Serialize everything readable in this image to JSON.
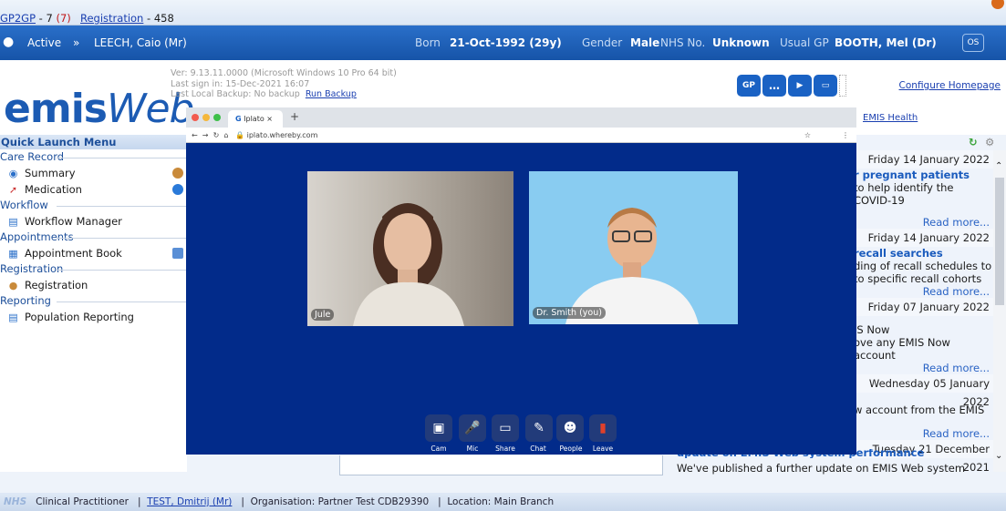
{
  "topbar": {
    "gp2gp_link": "GP2GP",
    "gp2gp_count": " - 7 ",
    "gp2gp_alert": "(7)",
    "registration_link": "Registration",
    "registration_count": " - 458"
  },
  "patient": {
    "status": "Active",
    "name": "LEECH, Caio (Mr)",
    "born_label": "Born",
    "born_value": "21-Oct-1992 (29y)",
    "gender_label": "Gender",
    "gender_value": "Male",
    "nhs_label": "NHS No.",
    "nhs_value": "Unknown",
    "gp_label": "Usual GP",
    "gp_value": "BOOTH, Mel (Dr)",
    "os_label": "OS"
  },
  "header": {
    "logo_main": "emis",
    "logo_italic": "Web",
    "version": "Ver: 9.13.11.0000 (Microsoft Windows 10 Pro 64 bit)",
    "last_sign_in": "Last sign in: 15-Dec-2021 16:07",
    "last_backup": "Last Local Backup: No backup",
    "run_backup": "Run Backup",
    "configure": "Configure Homepage",
    "emis_health": "EMIS Health",
    "toolbar": {
      "gp": "GP"
    }
  },
  "quick_launch": {
    "title": "Quick Launch Menu",
    "groups": [
      {
        "label": "Care Record",
        "items": [
          "Summary",
          "Medication"
        ]
      },
      {
        "label": "Workflow",
        "items": [
          "Workflow Manager"
        ]
      },
      {
        "label": "Appointments",
        "items": [
          "Appointment Book"
        ]
      },
      {
        "label": "Registration",
        "items": [
          "Registration"
        ]
      },
      {
        "label": "Reporting",
        "items": [
          "Population Reporting"
        ]
      }
    ]
  },
  "news": {
    "items": [
      {
        "date": "Friday 14 January 2022",
        "headline": "r pregnant patients",
        "body": "to help identify the COVID-19",
        "more": "Read more..."
      },
      {
        "date": "Friday 14 January 2022",
        "headline": "recall searches",
        "body1": "ding of recall schedules to",
        "body2": "to specific recall cohorts",
        "more": "Read more..."
      },
      {
        "date": "Friday 07 January 2022",
        "body1": "IS Now",
        "body2": "ove any EMIS Now account",
        "more": "Read more..."
      },
      {
        "date": "Wednesday 05 January 2022",
        "body1": "w account from the EMIS",
        "more": "Read more..."
      },
      {
        "date": "Tuesday 21 December 2021",
        "headline": "update on EMIS Web system performance",
        "body1": "We've published a further update on EMIS Web system"
      }
    ]
  },
  "video": {
    "tab_title": "Iplato",
    "url": "iplato.whereby.com",
    "participants": [
      {
        "name": "Jule"
      },
      {
        "name": "Dr. Smith (you)"
      }
    ],
    "controls": [
      {
        "label": "Cam",
        "icon": "camera-icon"
      },
      {
        "label": "Mic",
        "icon": "microphone-icon"
      },
      {
        "label": "Share",
        "icon": "screen-share-icon"
      },
      {
        "label": "Chat",
        "icon": "chat-icon"
      },
      {
        "label": "People",
        "icon": "people-icon"
      },
      {
        "label": "Leave",
        "icon": "leave-icon"
      }
    ],
    "leave_color": "#e0402a"
  },
  "statusbar": {
    "nhs": "NHS",
    "role": "Clinical Practitioner",
    "user": "TEST, Dmitrij (Mr)",
    "organisation": "Organisation: Partner Test CDB29390",
    "location": "Location: Main Branch"
  },
  "colors": {
    "banner": "#1654a8",
    "accent": "#1a5bbd",
    "video_bg": "#022b8a"
  }
}
